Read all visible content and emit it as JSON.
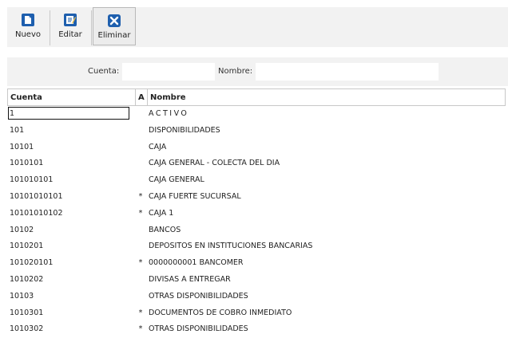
{
  "toolbar": {
    "nuevo_label": "Nuevo",
    "editar_label": "Editar",
    "eliminar_label": "Eliminar",
    "accent_color": "#1e5fae"
  },
  "filter": {
    "cuenta_label": "Cuenta:",
    "cuenta_value": "",
    "nombre_label": "Nombre:",
    "nombre_value": ""
  },
  "grid": {
    "headers": {
      "cuenta": "Cuenta",
      "a": "A",
      "nombre": "Nombre"
    },
    "rows": [
      {
        "cuenta": "1",
        "a": "",
        "nombre": "ACTIVO",
        "selected": true
      },
      {
        "cuenta": "101",
        "a": "",
        "nombre": "DISPONIBILIDADES"
      },
      {
        "cuenta": "10101",
        "a": "",
        "nombre": "CAJA"
      },
      {
        "cuenta": "1010101",
        "a": "",
        "nombre": "CAJA GENERAL - COLECTA DEL DIA"
      },
      {
        "cuenta": "101010101",
        "a": "",
        "nombre": "CAJA GENERAL"
      },
      {
        "cuenta": "10101010101",
        "a": "*",
        "nombre": "CAJA FUERTE SUCURSAL"
      },
      {
        "cuenta": "10101010102",
        "a": "*",
        "nombre": "CAJA 1"
      },
      {
        "cuenta": "10102",
        "a": "",
        "nombre": "BANCOS"
      },
      {
        "cuenta": "1010201",
        "a": "",
        "nombre": "DEPOSITOS EN INSTITUCIONES BANCARIAS"
      },
      {
        "cuenta": "101020101",
        "a": "*",
        "nombre": "0000000001 BANCOMER"
      },
      {
        "cuenta": "1010202",
        "a": "",
        "nombre": "DIVISAS A ENTREGAR"
      },
      {
        "cuenta": "10103",
        "a": "",
        "nombre": "OTRAS DISPONIBILIDADES"
      },
      {
        "cuenta": "1010301",
        "a": "*",
        "nombre": "DOCUMENTOS DE COBRO INMEDIATO"
      },
      {
        "cuenta": "1010302",
        "a": "*",
        "nombre": "OTRAS DISPONIBILIDADES"
      }
    ]
  }
}
